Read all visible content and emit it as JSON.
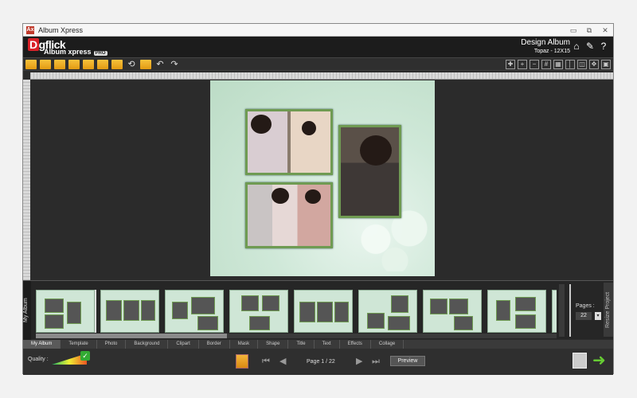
{
  "window": {
    "title": "Album Xpress",
    "app_icon": "Ax",
    "controls": [
      "▭",
      "⧉",
      "✕"
    ]
  },
  "header": {
    "logo": "D",
    "logo_rest": "gflick",
    "app_name": "Album xpress",
    "edition": "PRO",
    "mode": "Design Album",
    "album_size": "Topaz - 12X15",
    "icons": [
      "home-icon",
      "wrench-icon",
      "help-icon"
    ]
  },
  "toolbar": {
    "icons": [
      "open-folder-icon",
      "save-icon",
      "save-as-icon",
      "export-icon",
      "print-icon",
      "copy-icon",
      "paste-icon",
      "rotate-icon",
      "text-tool-icon",
      "undo-icon",
      "redo-icon"
    ],
    "right_icons": [
      "eyedropper-icon",
      "zoom-in-icon",
      "zoom-out-icon",
      "grid-icon",
      "grid-fine-icon",
      "guides-icon",
      "fit-page-icon",
      "move-icon",
      "actual-size-icon"
    ]
  },
  "filmstrip": {
    "title": "My Album",
    "thumb_count": 9,
    "pages_label": "Pages :",
    "pages_value": "22",
    "resize_label": "Resize Project"
  },
  "tabs": [
    "My Album",
    "Template",
    "Photo",
    "Background",
    "Clipart",
    "Border",
    "Mask",
    "Shape",
    "Title",
    "Text",
    "Effects",
    "Collage"
  ],
  "bottom": {
    "quality_label": "Quality :",
    "page_info": "Page 1 / 22",
    "preview_label": "Preview"
  },
  "colors": {
    "frame": "#6f9b52",
    "page_bg": "#cfe8d8",
    "accent_next": "#66cc33"
  }
}
